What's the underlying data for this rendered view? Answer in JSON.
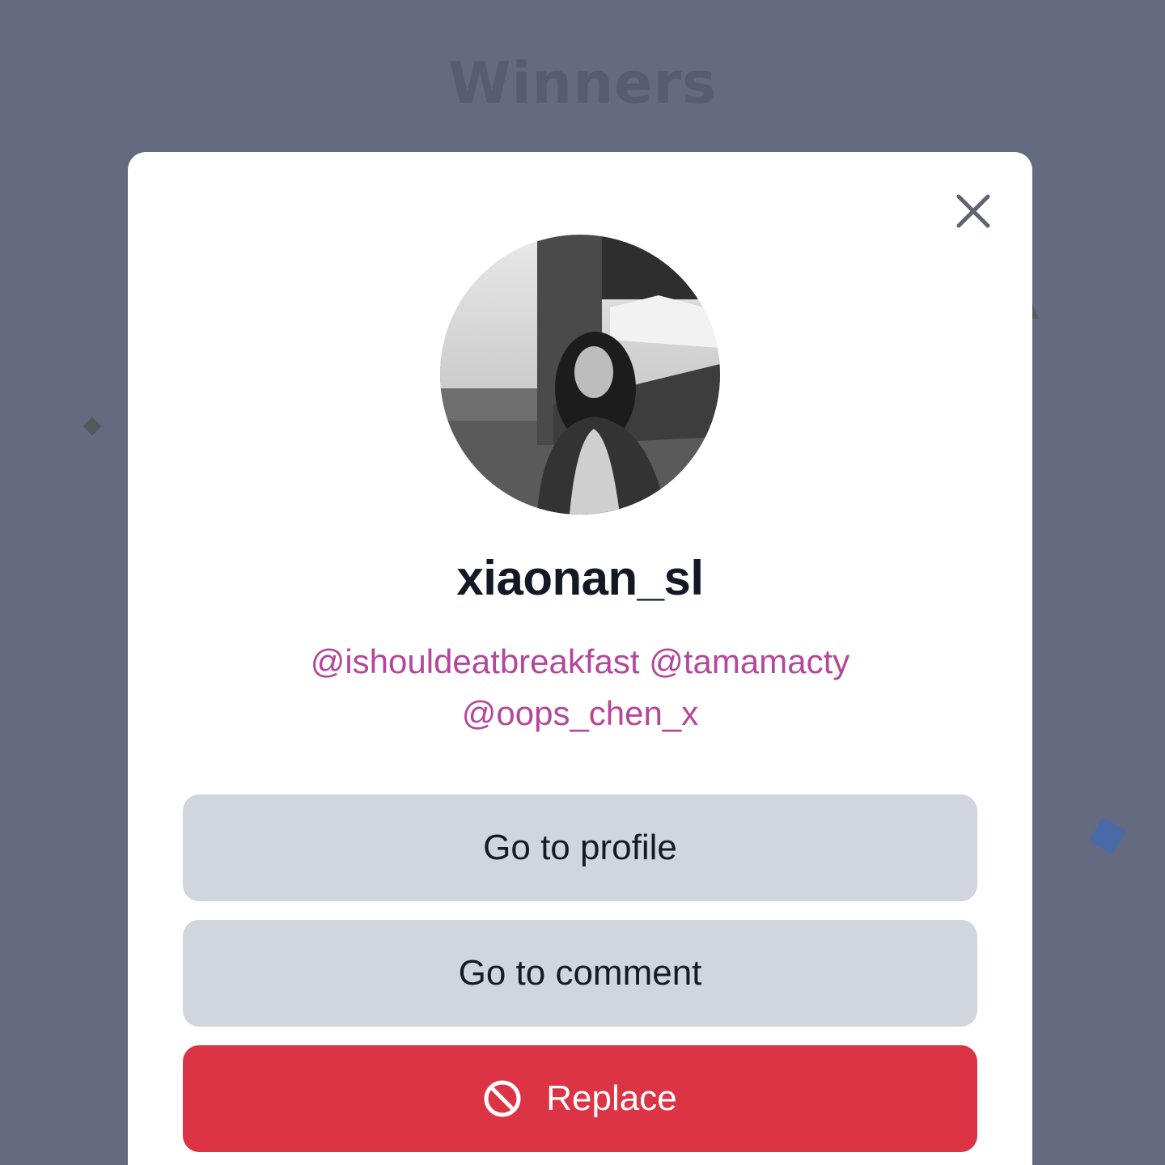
{
  "background": {
    "title": "Winners",
    "overlay_color": "#646b80"
  },
  "modal": {
    "close_icon": "close-icon",
    "avatar_icon": "user-photo",
    "username": "xiaonan_sl",
    "mentions_line1": "@ishouldeatbreakfast @tamamacty",
    "mentions_line2": "@oops_chen_x",
    "mention_color": "#b4479a",
    "buttons": {
      "go_to_profile": "Go to profile",
      "go_to_comment": "Go to comment",
      "replace": "Replace",
      "replace_icon": "ban-icon",
      "replace_color": "#dc3445",
      "secondary_color": "#d1d5dd"
    }
  }
}
